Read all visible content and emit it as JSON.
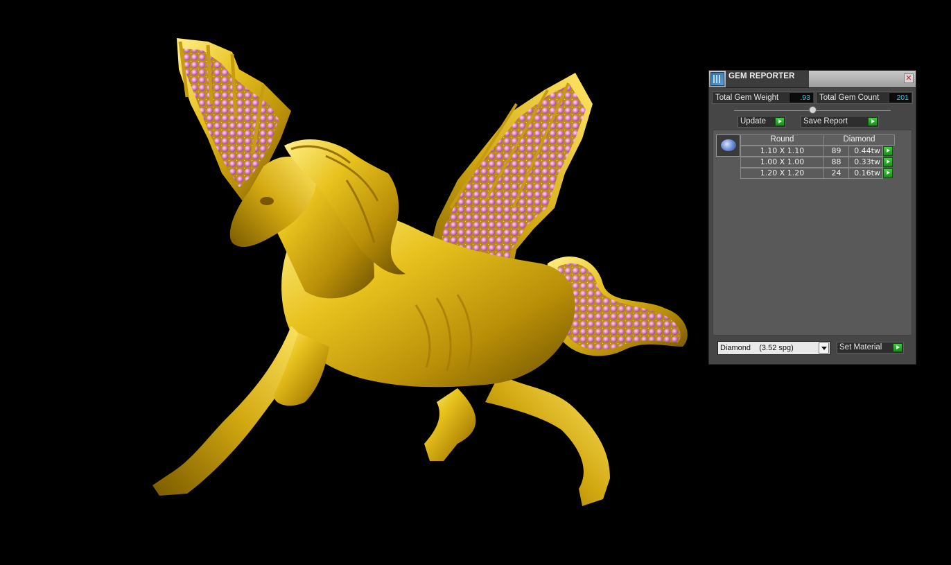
{
  "panel": {
    "title": "GEM REPORTER",
    "close_glyph": "✕",
    "total_gem_weight_label": "Total Gem Weight",
    "total_gem_weight_value": ".93",
    "total_gem_count_label": "Total Gem Count",
    "total_gem_count_value": "201",
    "update_label": "Update",
    "save_report_label": "Save Report",
    "table": {
      "shape_header": "Round",
      "material_header": "Diamond",
      "rows": [
        {
          "size": "1.10 X 1.10",
          "count": "89",
          "weight": "0.44tw"
        },
        {
          "size": "1.00 X 1.00",
          "count": "88",
          "weight": "0.33tw"
        },
        {
          "size": "1.20 X 1.20",
          "count": "24",
          "weight": "0.16tw"
        }
      ]
    },
    "material_select_value": "Diamond    (3.52 spg)",
    "set_material_label": "Set Material"
  },
  "colors": {
    "gold": "#d9b21a",
    "gem_pink": "#e68ad6",
    "value_cyan": "#41c8e8",
    "go_green": "#2aa82a"
  }
}
